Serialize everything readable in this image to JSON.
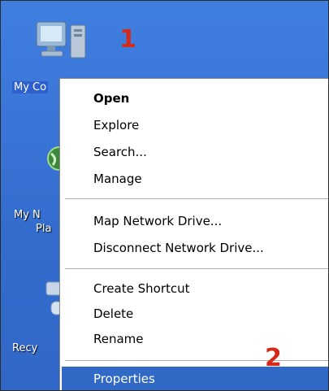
{
  "desktop_icons": [
    {
      "name": "my-computer",
      "label": "My Co"
    },
    {
      "name": "my-network-places",
      "label_line1": "My N",
      "label_line2": "Pla"
    },
    {
      "name": "recycle-bin",
      "label": "Recy"
    }
  ],
  "annotations": {
    "step1": "1",
    "step2": "2",
    "color": "#d42a1a"
  },
  "context_menu": {
    "items": [
      {
        "label": "Open",
        "bold": true
      },
      {
        "label": "Explore"
      },
      {
        "label": "Search..."
      },
      {
        "label": "Manage"
      },
      {
        "label": "Map Network Drive..."
      },
      {
        "label": "Disconnect Network Drive..."
      },
      {
        "label": "Create Shortcut"
      },
      {
        "label": "Delete"
      },
      {
        "label": "Rename"
      },
      {
        "label": "Properties",
        "highlighted": true
      }
    ]
  },
  "colors": {
    "desktop": "#3a76d8",
    "highlight": "#3169c6",
    "step": "#d42a1a"
  }
}
